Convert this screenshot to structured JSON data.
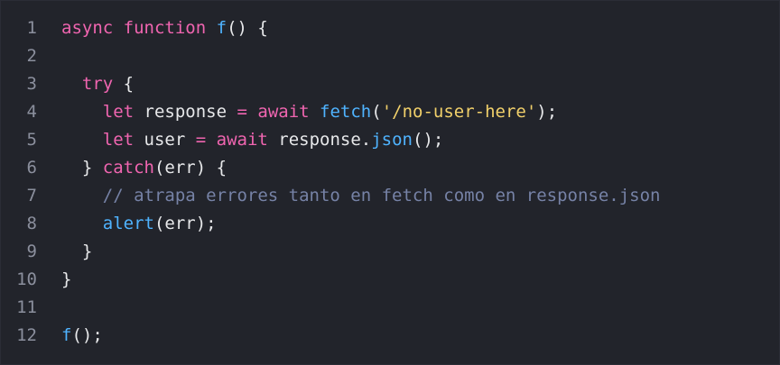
{
  "editor": {
    "colors": {
      "background": "#22242b",
      "line_number": "#8b8f9d",
      "plain": "#e7e8ea",
      "keyword": "#f065b0",
      "function": "#4fb3ff",
      "string": "#f1d06a",
      "comment": "#7682a6"
    },
    "lines": [
      {
        "number": "1",
        "tokens": [
          {
            "text": "async",
            "type": "keyword"
          },
          {
            "text": " ",
            "type": "plain"
          },
          {
            "text": "function",
            "type": "keyword"
          },
          {
            "text": " ",
            "type": "plain"
          },
          {
            "text": "f",
            "type": "function"
          },
          {
            "text": "() {",
            "type": "plain"
          }
        ]
      },
      {
        "number": "2",
        "tokens": []
      },
      {
        "number": "3",
        "tokens": [
          {
            "text": "  ",
            "type": "plain"
          },
          {
            "text": "try",
            "type": "keyword"
          },
          {
            "text": " {",
            "type": "plain"
          }
        ]
      },
      {
        "number": "4",
        "tokens": [
          {
            "text": "    ",
            "type": "plain"
          },
          {
            "text": "let",
            "type": "keyword"
          },
          {
            "text": " response ",
            "type": "plain"
          },
          {
            "text": "=",
            "type": "keyword"
          },
          {
            "text": " ",
            "type": "plain"
          },
          {
            "text": "await",
            "type": "keyword"
          },
          {
            "text": " ",
            "type": "plain"
          },
          {
            "text": "fetch",
            "type": "function"
          },
          {
            "text": "(",
            "type": "plain"
          },
          {
            "text": "'/no-user-here'",
            "type": "string"
          },
          {
            "text": ");",
            "type": "plain"
          }
        ]
      },
      {
        "number": "5",
        "tokens": [
          {
            "text": "    ",
            "type": "plain"
          },
          {
            "text": "let",
            "type": "keyword"
          },
          {
            "text": " user ",
            "type": "plain"
          },
          {
            "text": "=",
            "type": "keyword"
          },
          {
            "text": " ",
            "type": "plain"
          },
          {
            "text": "await",
            "type": "keyword"
          },
          {
            "text": " response.",
            "type": "plain"
          },
          {
            "text": "json",
            "type": "function"
          },
          {
            "text": "();",
            "type": "plain"
          }
        ]
      },
      {
        "number": "6",
        "tokens": [
          {
            "text": "  } ",
            "type": "plain"
          },
          {
            "text": "catch",
            "type": "keyword"
          },
          {
            "text": "(err) {",
            "type": "plain"
          }
        ]
      },
      {
        "number": "7",
        "tokens": [
          {
            "text": "    ",
            "type": "plain"
          },
          {
            "text": "// atrapa errores tanto en fetch como en response.json",
            "type": "comment"
          }
        ]
      },
      {
        "number": "8",
        "tokens": [
          {
            "text": "    ",
            "type": "plain"
          },
          {
            "text": "alert",
            "type": "function"
          },
          {
            "text": "(err);",
            "type": "plain"
          }
        ]
      },
      {
        "number": "9",
        "tokens": [
          {
            "text": "  }",
            "type": "plain"
          }
        ]
      },
      {
        "number": "10",
        "tokens": [
          {
            "text": "}",
            "type": "plain"
          }
        ]
      },
      {
        "number": "11",
        "tokens": []
      },
      {
        "number": "12",
        "tokens": [
          {
            "text": "f",
            "type": "function"
          },
          {
            "text": "();",
            "type": "plain"
          }
        ]
      }
    ]
  }
}
